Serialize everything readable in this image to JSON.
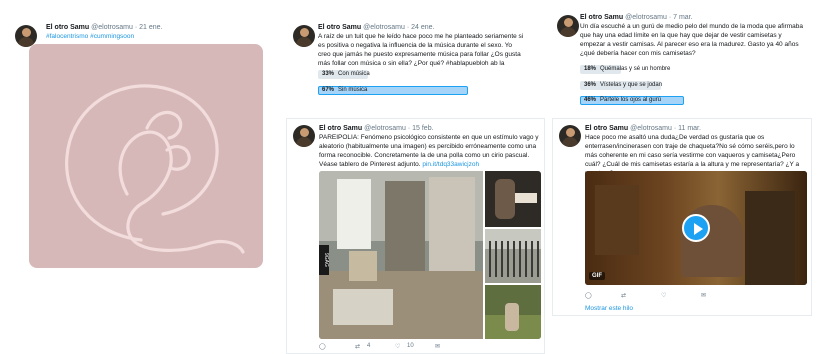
{
  "author": {
    "name": "El otro Samu",
    "handle": "@elotrosamu"
  },
  "tweet1": {
    "date": "21 ene.",
    "text": "#falocentrismo #cummingsoon",
    "image_color": "#d6b8b8"
  },
  "tweet2": {
    "date": "24 ene.",
    "text": "A raíz de un tuit que he leído hace poco me he planteado seriamente si es positiva o negativa la influencia de la música durante el sexo. Yo creo que jamás he puesto expresamente música para follar ¿Os gusta más follar con música o sin ella? ¿Por qué? #hablapuebloh ab la",
    "poll": [
      {
        "pct": "33%",
        "label": "Con música",
        "value": 33,
        "winner": false
      },
      {
        "pct": "67%",
        "label": "Sin música",
        "value": 67,
        "winner": true
      }
    ]
  },
  "tweet3": {
    "date": "7 mar.",
    "text": "Un día escuché a un gurú de medio pelo del mundo de la moda que afirmaba que hay una edad límite en la que hay que dejar de vestir camisetas y empezar a vestir camisas. Al parecer eso era la madurez. Gasto ya 40 años ¿qué debería hacer con mis camisetas?",
    "poll": [
      {
        "pct": "18%",
        "label": "Quémalas y sé un hombre",
        "value": 18,
        "winner": false
      },
      {
        "pct": "36%",
        "label": "Vístelas y que se jodan",
        "value": 36,
        "winner": false
      },
      {
        "pct": "46%",
        "label": "Pártele los ojos al gurú",
        "value": 46,
        "winner": true
      }
    ]
  },
  "tweet4": {
    "date": "15 feb.",
    "text": "PAREIPOLIA: Fenómeno psicológico consistente en que un estímulo vago y aleatorio (habitualmente una imagen) es percibido erróneamente como una forma reconocible. Concretamente la de una polla como un cirio pascual. Véase tablero de Pinterest adjunto.",
    "link": "pin.it/tdq33awicjzoh",
    "watermark": "9GAG",
    "retweets": "4",
    "likes": "10"
  },
  "tweet5": {
    "date": "11 mar.",
    "text": "Hace poco me asaltó una duda¿De verdad os gustaría que os enterrasen/incinerasen con traje de chaqueta?No sé cómo seréis,pero lo más coherente en mi caso sería vestirme con vaqueros y camiseta¿Pero cuál? ¿Cuál de mis camisetas estaría a la altura y me representaría? ¿Y a vosotros?",
    "gif_label": "GIF",
    "thread_link": "Mostrar este hilo"
  }
}
